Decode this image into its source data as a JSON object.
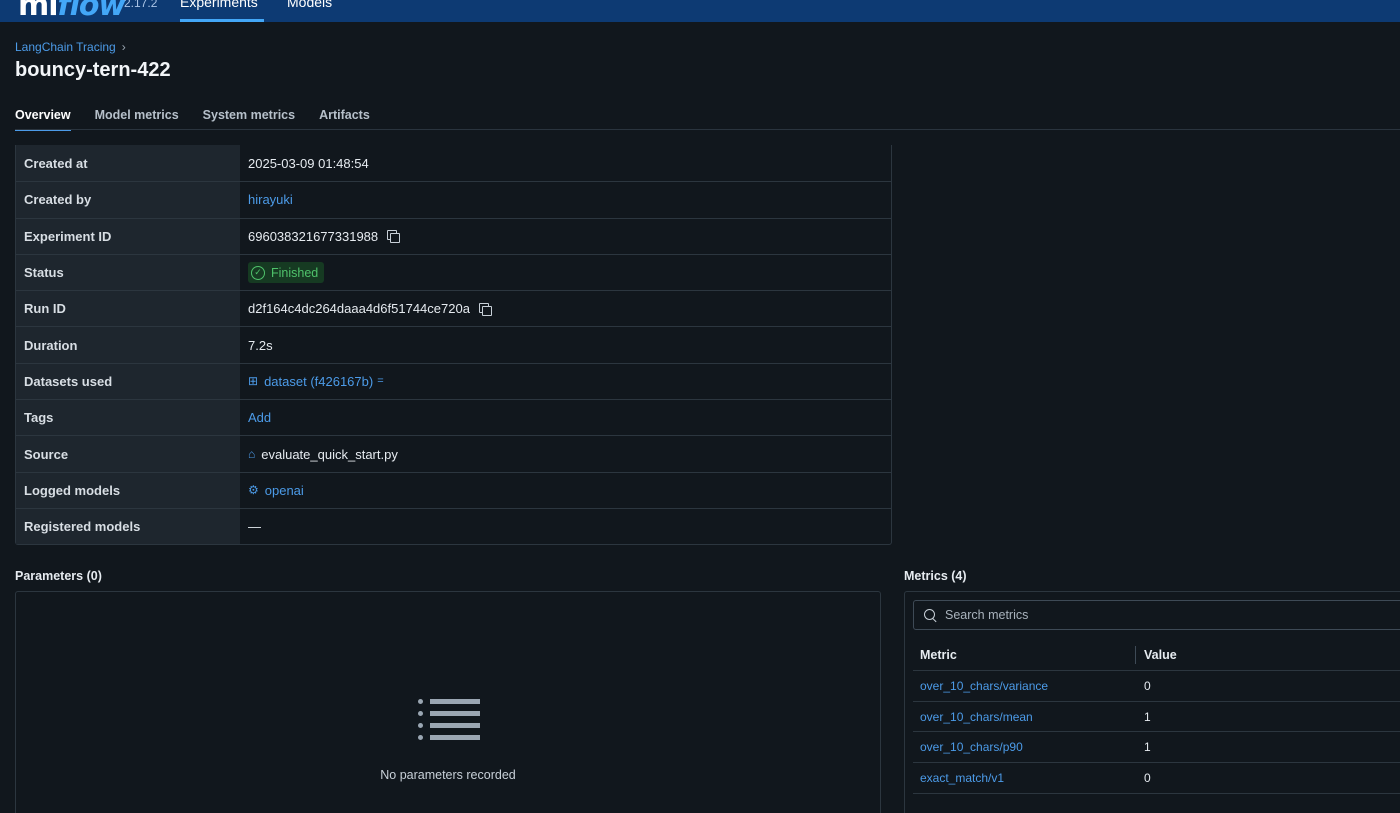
{
  "topbar": {
    "logo_prefix": "ml",
    "logo_suffix": "flow",
    "version": "2.17.2",
    "nav": [
      "Experiments",
      "Models"
    ]
  },
  "breadcrumb": {
    "experiment": "LangChain Tracing",
    "separator": "›"
  },
  "page_title": "bouncy-tern-422",
  "tabs": [
    "Overview",
    "Model metrics",
    "System metrics",
    "Artifacts"
  ],
  "details": {
    "created_at": {
      "label": "Created at",
      "value": "2025-03-09 01:48:54"
    },
    "created_by": {
      "label": "Created by",
      "value": "hirayuki"
    },
    "experiment_id": {
      "label": "Experiment ID",
      "value": "696038321677331988"
    },
    "status": {
      "label": "Status",
      "value": "Finished"
    },
    "run_id": {
      "label": "Run ID",
      "value": "d2f164c4dc264daaa4d6f51744ce720a"
    },
    "duration": {
      "label": "Duration",
      "value": "7.2s"
    },
    "datasets_used": {
      "label": "Datasets used",
      "value": "dataset (f426167b)"
    },
    "tags": {
      "label": "Tags",
      "value": "Add"
    },
    "source": {
      "label": "Source",
      "value": "evaluate_quick_start.py"
    },
    "logged_models": {
      "label": "Logged models",
      "value": "openai"
    },
    "registered_models": {
      "label": "Registered models",
      "value": "—"
    }
  },
  "parameters": {
    "title": "Parameters (0)",
    "empty_text": "No parameters recorded"
  },
  "metrics": {
    "title": "Metrics (4)",
    "search_placeholder": "Search metrics",
    "columns": [
      "Metric",
      "Value"
    ],
    "rows": [
      {
        "name": "over_10_chars/variance",
        "value": "0"
      },
      {
        "name": "over_10_chars/mean",
        "value": "1"
      },
      {
        "name": "over_10_chars/p90",
        "value": "1"
      },
      {
        "name": "exact_match/v1",
        "value": "0"
      }
    ]
  },
  "colors": {
    "topbar": "#0d3a73",
    "accent": "#4c9be8",
    "background": "#11171d",
    "status_success": "#4fc26b"
  }
}
